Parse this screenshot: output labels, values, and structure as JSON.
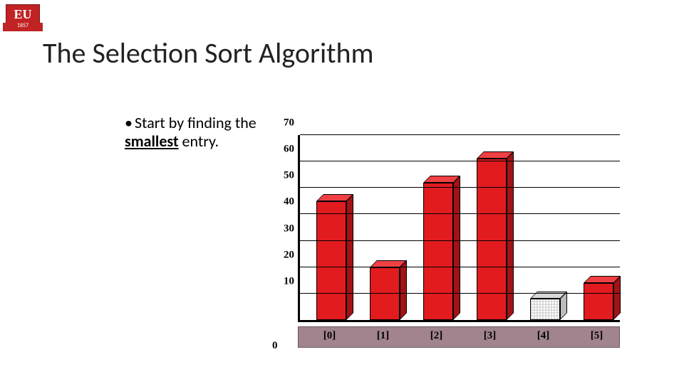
{
  "logo": {
    "text": "EU",
    "year": "1857"
  },
  "title": "The Selection Sort Algorithm",
  "bullet": {
    "prefix": "Start by finding the ",
    "emph": "smallest",
    "suffix": " entry."
  },
  "chart_data": {
    "type": "bar",
    "title": "",
    "xlabel": "",
    "ylabel": "",
    "ylim": [
      0,
      70
    ],
    "y_ticks": [
      0,
      10,
      20,
      30,
      40,
      50,
      60,
      70
    ],
    "categories": [
      "[0]",
      "[1]",
      "[2]",
      "[3]",
      "[4]",
      "[5]"
    ],
    "values": [
      45,
      20,
      52,
      61,
      8,
      14
    ],
    "highlight_index": 4,
    "colors": {
      "normal": "#e11b1e",
      "highlight": "#d0d0d0"
    }
  }
}
